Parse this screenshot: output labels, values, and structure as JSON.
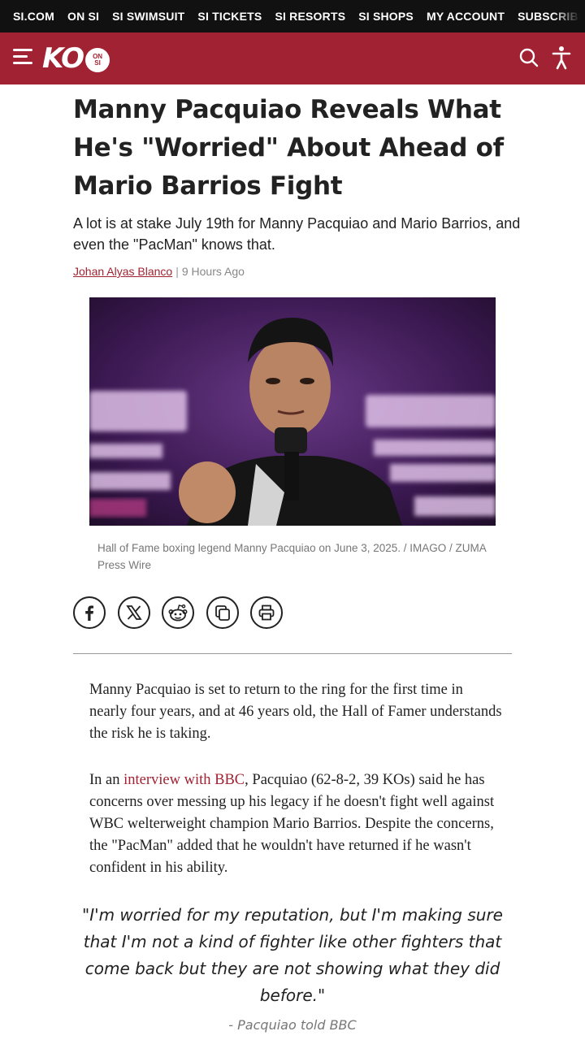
{
  "topnav": {
    "links": [
      "SI.COM",
      "ON SI",
      "SI SWIMSUIT",
      "SI TICKETS",
      "SI RESORTS",
      "SI SHOPS",
      "MY ACCOUNT",
      "SUBSCRIBE NOW"
    ]
  },
  "header": {
    "logo_text": "KO",
    "logo_badge_line1": "ON",
    "logo_badge_line2": "SI",
    "menu_icon": "hamburger-menu-icon",
    "search_icon": "search-icon",
    "accessibility_icon": "accessibility-icon",
    "brand_color": "#a12333"
  },
  "article": {
    "headline": "Manny Pacquiao Reveals What He's \"Worried\" About Ahead of Mario Barrios Fight",
    "dek": "A lot is at stake July 19th for Manny Pacquiao and Mario Barrios, and even the \"PacMan\" knows that.",
    "author": "Johan Alyas Blanco",
    "byline_separator": "|",
    "timestamp": "9 Hours Ago",
    "image_caption": "Hall of Fame boxing legend Manny Pacquiao on June 3, 2025. / IMAGO / ZUMA Press Wire",
    "share_icons": [
      "facebook-icon",
      "x-twitter-icon",
      "reddit-icon",
      "copy-link-icon",
      "print-icon"
    ],
    "paragraph1": "Manny Pacquiao is set to return to the ring for the first time in nearly four years, and at 46 years old, the Hall of Famer understands the risk he is taking.",
    "paragraph2_link": "interview with BBC",
    "paragraph2_before": "In an ",
    "paragraph2_after": ", Pacquiao (62-8-2, 39 KOs) said he has concerns over messing up his legacy if he doesn't fight well against WBC welterweight champion Mario Barrios. Despite the concerns, the \"PacMan\" added that he wouldn't have returned if he wasn't confident in his ability.",
    "pullquote": "\"I'm worried for my reputation, but I'm making sure that I'm not a kind of fighter like other fighters that come back but they are not showing what they did before.\"",
    "pullquote_attribution": "- Pacquiao told BBC"
  }
}
